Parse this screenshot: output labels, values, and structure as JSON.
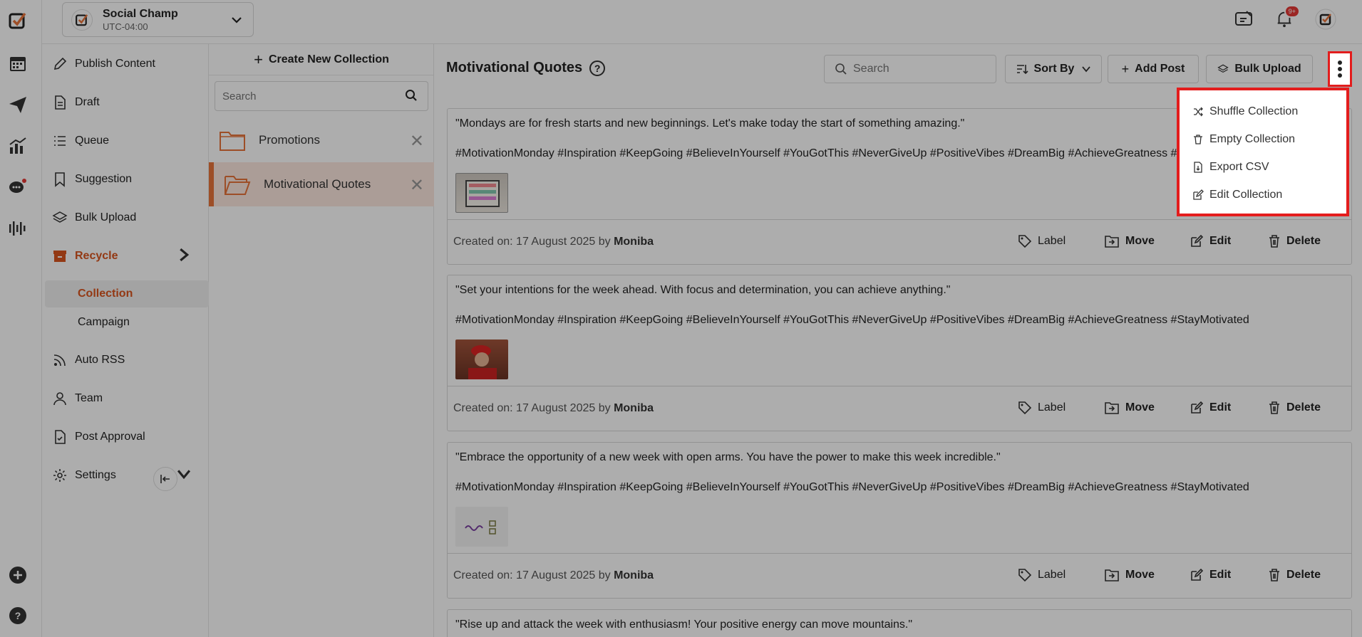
{
  "workspace": {
    "name": "Social Champ",
    "timezone": "UTC-04:00"
  },
  "topbar": {
    "notification_badge": "9+"
  },
  "sidebar": {
    "items": [
      {
        "label": "Publish Content",
        "icon": "pen-icon"
      },
      {
        "label": "Draft",
        "icon": "document-icon"
      },
      {
        "label": "Queue",
        "icon": "list-icon"
      },
      {
        "label": "Suggestion",
        "icon": "bookmark-icon"
      },
      {
        "label": "Bulk Upload",
        "icon": "layers-icon"
      },
      {
        "label": "Recycle",
        "icon": "archive-icon"
      },
      {
        "label": "Auto RSS",
        "icon": "rss-icon"
      },
      {
        "label": "Team",
        "icon": "user-icon"
      },
      {
        "label": "Post Approval",
        "icon": "approval-document-icon"
      },
      {
        "label": "Settings",
        "icon": "gear-icon"
      }
    ],
    "sub_items": [
      "Collection",
      "Campaign"
    ]
  },
  "collections": {
    "create_label": "Create New Collection",
    "search_placeholder": "Search",
    "items": [
      "Promotions",
      "Motivational Quotes"
    ]
  },
  "main": {
    "title": "Motivational Quotes",
    "search_placeholder": "Search",
    "sort_label": "Sort By",
    "add_post_label": "Add Post",
    "bulk_upload_label": "Bulk Upload",
    "posts": [
      {
        "quote": "\"Mondays are for fresh starts and new beginnings. Let's make today the start of something amazing.\"",
        "tags": "#MotivationMonday #Inspiration #KeepGoing #BelieveInYourself #YouGotThis #NeverGiveUp #PositiveVibes #DreamBig #AchieveGreatness #StayMotivated",
        "created": "Created on: 17 August 2025 by",
        "author": "Moniba"
      },
      {
        "quote": "\"Set your intentions for the week ahead. With focus and determination, you can achieve anything.\"",
        "tags": "#MotivationMonday #Inspiration #KeepGoing #BelieveInYourself #YouGotThis #NeverGiveUp #PositiveVibes #DreamBig #AchieveGreatness #StayMotivated",
        "created": "Created on: 17 August 2025 by",
        "author": "Moniba"
      },
      {
        "quote": "\"Embrace the opportunity of a new week with open arms. You have the power to make this week incredible.\"",
        "tags": "#MotivationMonday #Inspiration #KeepGoing #BelieveInYourself #YouGotThis #NeverGiveUp #PositiveVibes #DreamBig #AchieveGreatness #StayMotivated",
        "created": "Created on: 17 August 2025 by",
        "author": "Moniba"
      },
      {
        "quote": "\"Rise up and attack the week with enthusiasm! Your positive energy can move mountains.\""
      }
    ],
    "actions": {
      "label": "Label",
      "move": "Move",
      "edit": "Edit",
      "delete": "Delete"
    }
  },
  "dropdown": {
    "items": [
      "Shuffle Collection",
      "Empty Collection",
      "Export CSV",
      "Edit Collection"
    ]
  },
  "colors": {
    "accent": "#d9541e",
    "highlight": "#e31d1d",
    "active_bg": "#fde8df"
  }
}
